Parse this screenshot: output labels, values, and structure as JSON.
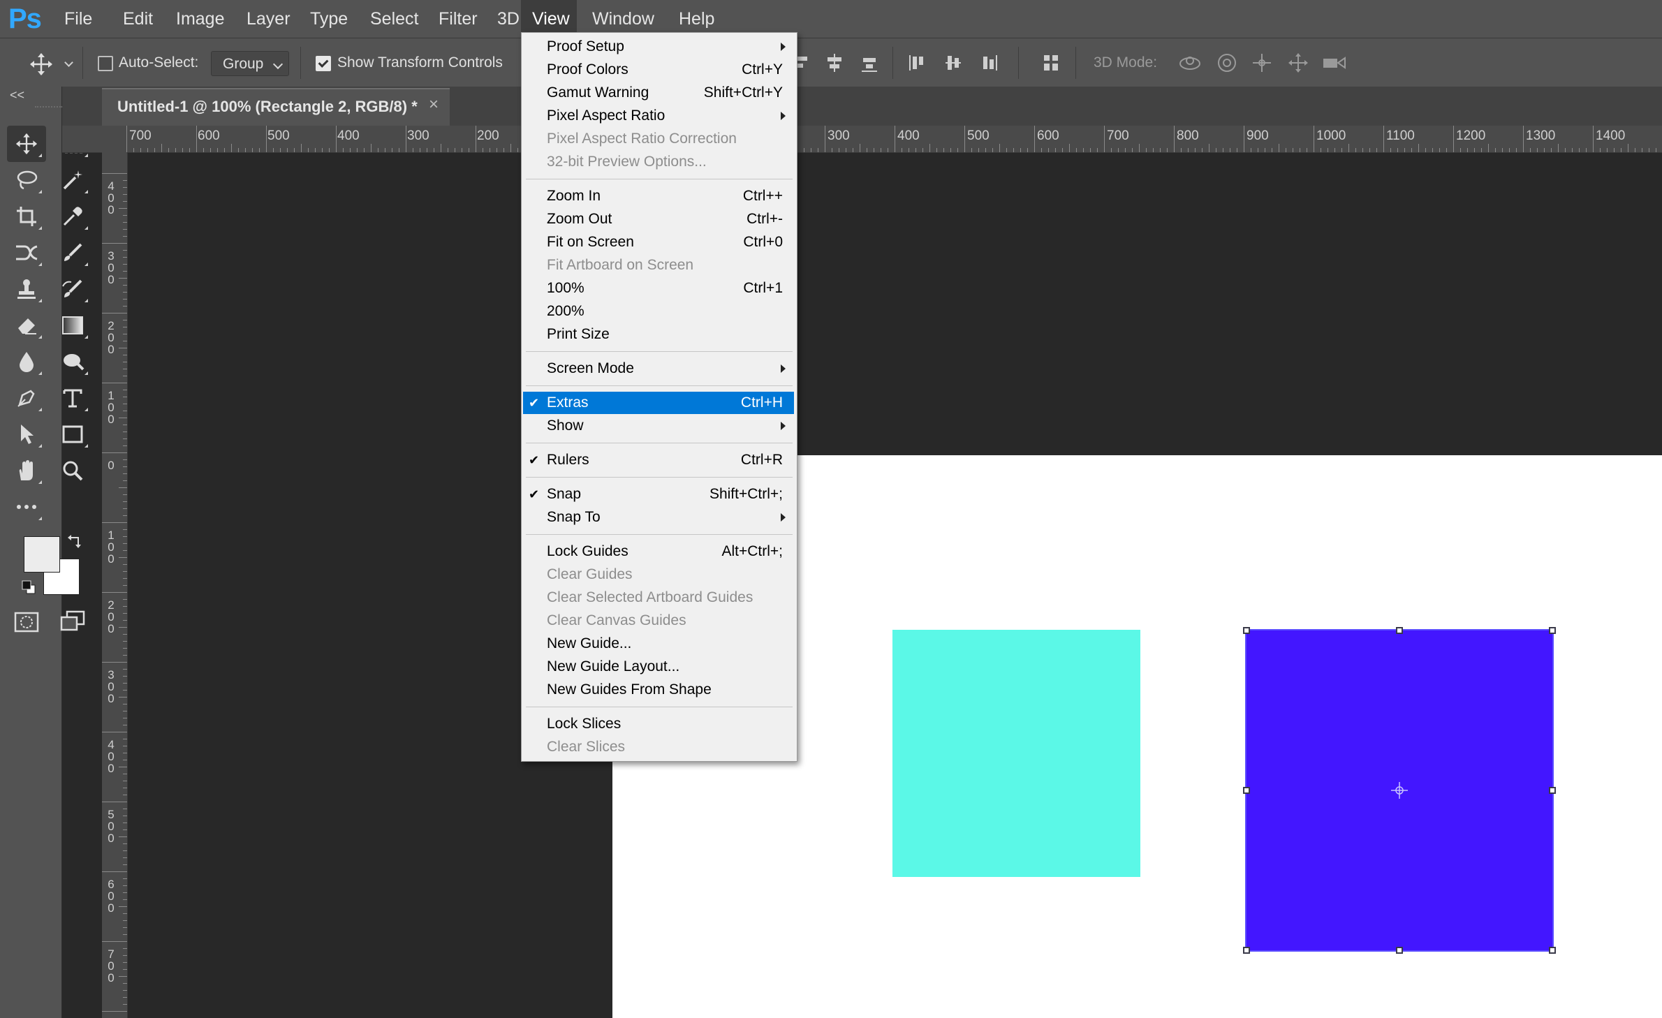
{
  "app": {
    "logo": "Ps",
    "accent": "#31a8ff"
  },
  "menubar": {
    "items": [
      "File",
      "Edit",
      "Image",
      "Layer",
      "Type",
      "Select",
      "Filter",
      "3D",
      "View",
      "Window",
      "Help"
    ],
    "active": "View"
  },
  "options": {
    "tool_icon": "move-icon",
    "auto_select_label": "Auto-Select:",
    "auto_select_checked": false,
    "auto_select_value": "Group",
    "show_transform_label": "Show Transform Controls",
    "show_transform_checked": true,
    "three_d_label": "3D Mode:"
  },
  "tools": {
    "selected": "move-tool",
    "list": [
      "move-tool",
      "marquee-tool",
      "lasso-tool",
      "magic-wand-tool",
      "crop-tool",
      "eyedropper-tool",
      "healing-tool",
      "brush-tool",
      "stamp-tool",
      "history-brush-tool",
      "eraser-tool",
      "gradient-tool",
      "blur-tool",
      "dodge-tool",
      "pen-tool",
      "type-tool",
      "path-select-tool",
      "rectangle-tool",
      "hand-tool",
      "zoom-tool",
      "more-tools"
    ],
    "foreground": "#ececec",
    "background": "#ffffff",
    "collapse_glyph": "<<"
  },
  "document": {
    "tab_title": "Untitled-1 @ 100% (Rectangle 2, RGB/8) *",
    "close_glyph": "×"
  },
  "ruler_top": {
    "labels_left": [
      "700",
      "600",
      "500",
      "400",
      "300",
      "200"
    ],
    "labels_right": [
      "300",
      "400",
      "500",
      "600",
      "700",
      "800",
      "900",
      "1000",
      "1100",
      "1200",
      "1300",
      "1400"
    ]
  },
  "ruler_left": {
    "labels": [
      "400",
      "300",
      "200",
      "100",
      "0",
      "100",
      "200",
      "300",
      "400",
      "500",
      "600",
      "700"
    ]
  },
  "canvas": {
    "pasteboard_color": "#282828",
    "artboard_color": "#ffffff",
    "shape_1_color": "#5bf8e7",
    "shape_2_color": "#4316ff"
  },
  "view_menu": {
    "items": [
      {
        "label": "Proof Setup",
        "shortcut": "",
        "submenu": true,
        "disabled": false,
        "checked": false
      },
      {
        "label": "Proof Colors",
        "shortcut": "Ctrl+Y",
        "submenu": false,
        "disabled": false,
        "checked": false
      },
      {
        "label": "Gamut Warning",
        "shortcut": "Shift+Ctrl+Y",
        "submenu": false,
        "disabled": false,
        "checked": false
      },
      {
        "label": "Pixel Aspect Ratio",
        "shortcut": "",
        "submenu": true,
        "disabled": false,
        "checked": false
      },
      {
        "label": "Pixel Aspect Ratio Correction",
        "shortcut": "",
        "submenu": false,
        "disabled": true,
        "checked": false
      },
      {
        "label": "32-bit Preview Options...",
        "shortcut": "",
        "submenu": false,
        "disabled": true,
        "checked": false
      },
      {
        "separator": true
      },
      {
        "label": "Zoom In",
        "shortcut": "Ctrl++",
        "submenu": false,
        "disabled": false,
        "checked": false
      },
      {
        "label": "Zoom Out",
        "shortcut": "Ctrl+-",
        "submenu": false,
        "disabled": false,
        "checked": false
      },
      {
        "label": "Fit on Screen",
        "shortcut": "Ctrl+0",
        "submenu": false,
        "disabled": false,
        "checked": false
      },
      {
        "label": "Fit Artboard on Screen",
        "shortcut": "",
        "submenu": false,
        "disabled": true,
        "checked": false
      },
      {
        "label": "100%",
        "shortcut": "Ctrl+1",
        "submenu": false,
        "disabled": false,
        "checked": false
      },
      {
        "label": "200%",
        "shortcut": "",
        "submenu": false,
        "disabled": false,
        "checked": false
      },
      {
        "label": "Print Size",
        "shortcut": "",
        "submenu": false,
        "disabled": false,
        "checked": false
      },
      {
        "separator": true
      },
      {
        "label": "Screen Mode",
        "shortcut": "",
        "submenu": true,
        "disabled": false,
        "checked": false
      },
      {
        "separator": true
      },
      {
        "label": "Extras",
        "shortcut": "Ctrl+H",
        "submenu": false,
        "disabled": false,
        "checked": true,
        "highlight": true
      },
      {
        "label": "Show",
        "shortcut": "",
        "submenu": true,
        "disabled": false,
        "checked": false
      },
      {
        "separator": true
      },
      {
        "label": "Rulers",
        "shortcut": "Ctrl+R",
        "submenu": false,
        "disabled": false,
        "checked": true
      },
      {
        "separator": true
      },
      {
        "label": "Snap",
        "shortcut": "Shift+Ctrl+;",
        "submenu": false,
        "disabled": false,
        "checked": true
      },
      {
        "label": "Snap To",
        "shortcut": "",
        "submenu": true,
        "disabled": false,
        "checked": false
      },
      {
        "separator": true
      },
      {
        "label": "Lock Guides",
        "shortcut": "Alt+Ctrl+;",
        "submenu": false,
        "disabled": false,
        "checked": false
      },
      {
        "label": "Clear Guides",
        "shortcut": "",
        "submenu": false,
        "disabled": true,
        "checked": false
      },
      {
        "label": "Clear Selected Artboard Guides",
        "shortcut": "",
        "submenu": false,
        "disabled": true,
        "checked": false
      },
      {
        "label": "Clear Canvas Guides",
        "shortcut": "",
        "submenu": false,
        "disabled": true,
        "checked": false
      },
      {
        "label": "New Guide...",
        "shortcut": "",
        "submenu": false,
        "disabled": false,
        "checked": false
      },
      {
        "label": "New Guide Layout...",
        "shortcut": "",
        "submenu": false,
        "disabled": false,
        "checked": false
      },
      {
        "label": "New Guides From Shape",
        "shortcut": "",
        "submenu": false,
        "disabled": false,
        "checked": false
      },
      {
        "separator": true
      },
      {
        "label": "Lock Slices",
        "shortcut": "",
        "submenu": false,
        "disabled": false,
        "checked": false
      },
      {
        "label": "Clear Slices",
        "shortcut": "",
        "submenu": false,
        "disabled": true,
        "checked": false
      }
    ],
    "highlight_color": "#0078d7"
  }
}
